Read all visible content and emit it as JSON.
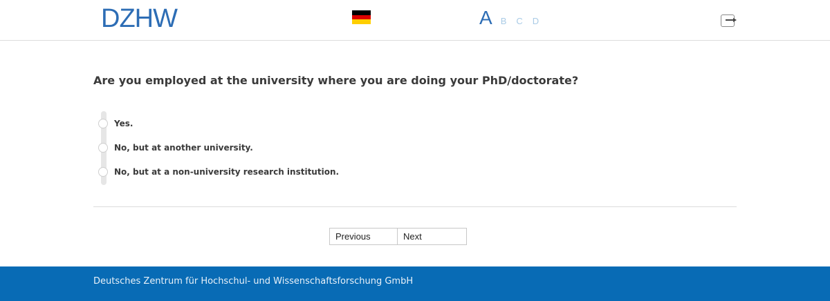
{
  "header": {
    "logo_text": "DZHW",
    "flag_colors": [
      "#000000",
      "#dd0000",
      "#ffce00"
    ],
    "language_icon": "german-flag-icon",
    "font_sizes": [
      "A",
      "B",
      "C",
      "D"
    ],
    "logout_icon": "logout-icon"
  },
  "question": {
    "text": "Are you employed at the university where you are doing your PhD/doctorate?",
    "options": [
      "Yes.",
      "No, but at another university.",
      "No, but at a non-university research institution."
    ]
  },
  "navigation": {
    "previous_label": "Previous",
    "next_label": "Next"
  },
  "footer": {
    "text": "Deutsches Zentrum für Hochschul- und Wissenschaftsforschung GmbH",
    "background": "#086bb5"
  },
  "colors": {
    "brand_blue": "#2d6db5"
  }
}
